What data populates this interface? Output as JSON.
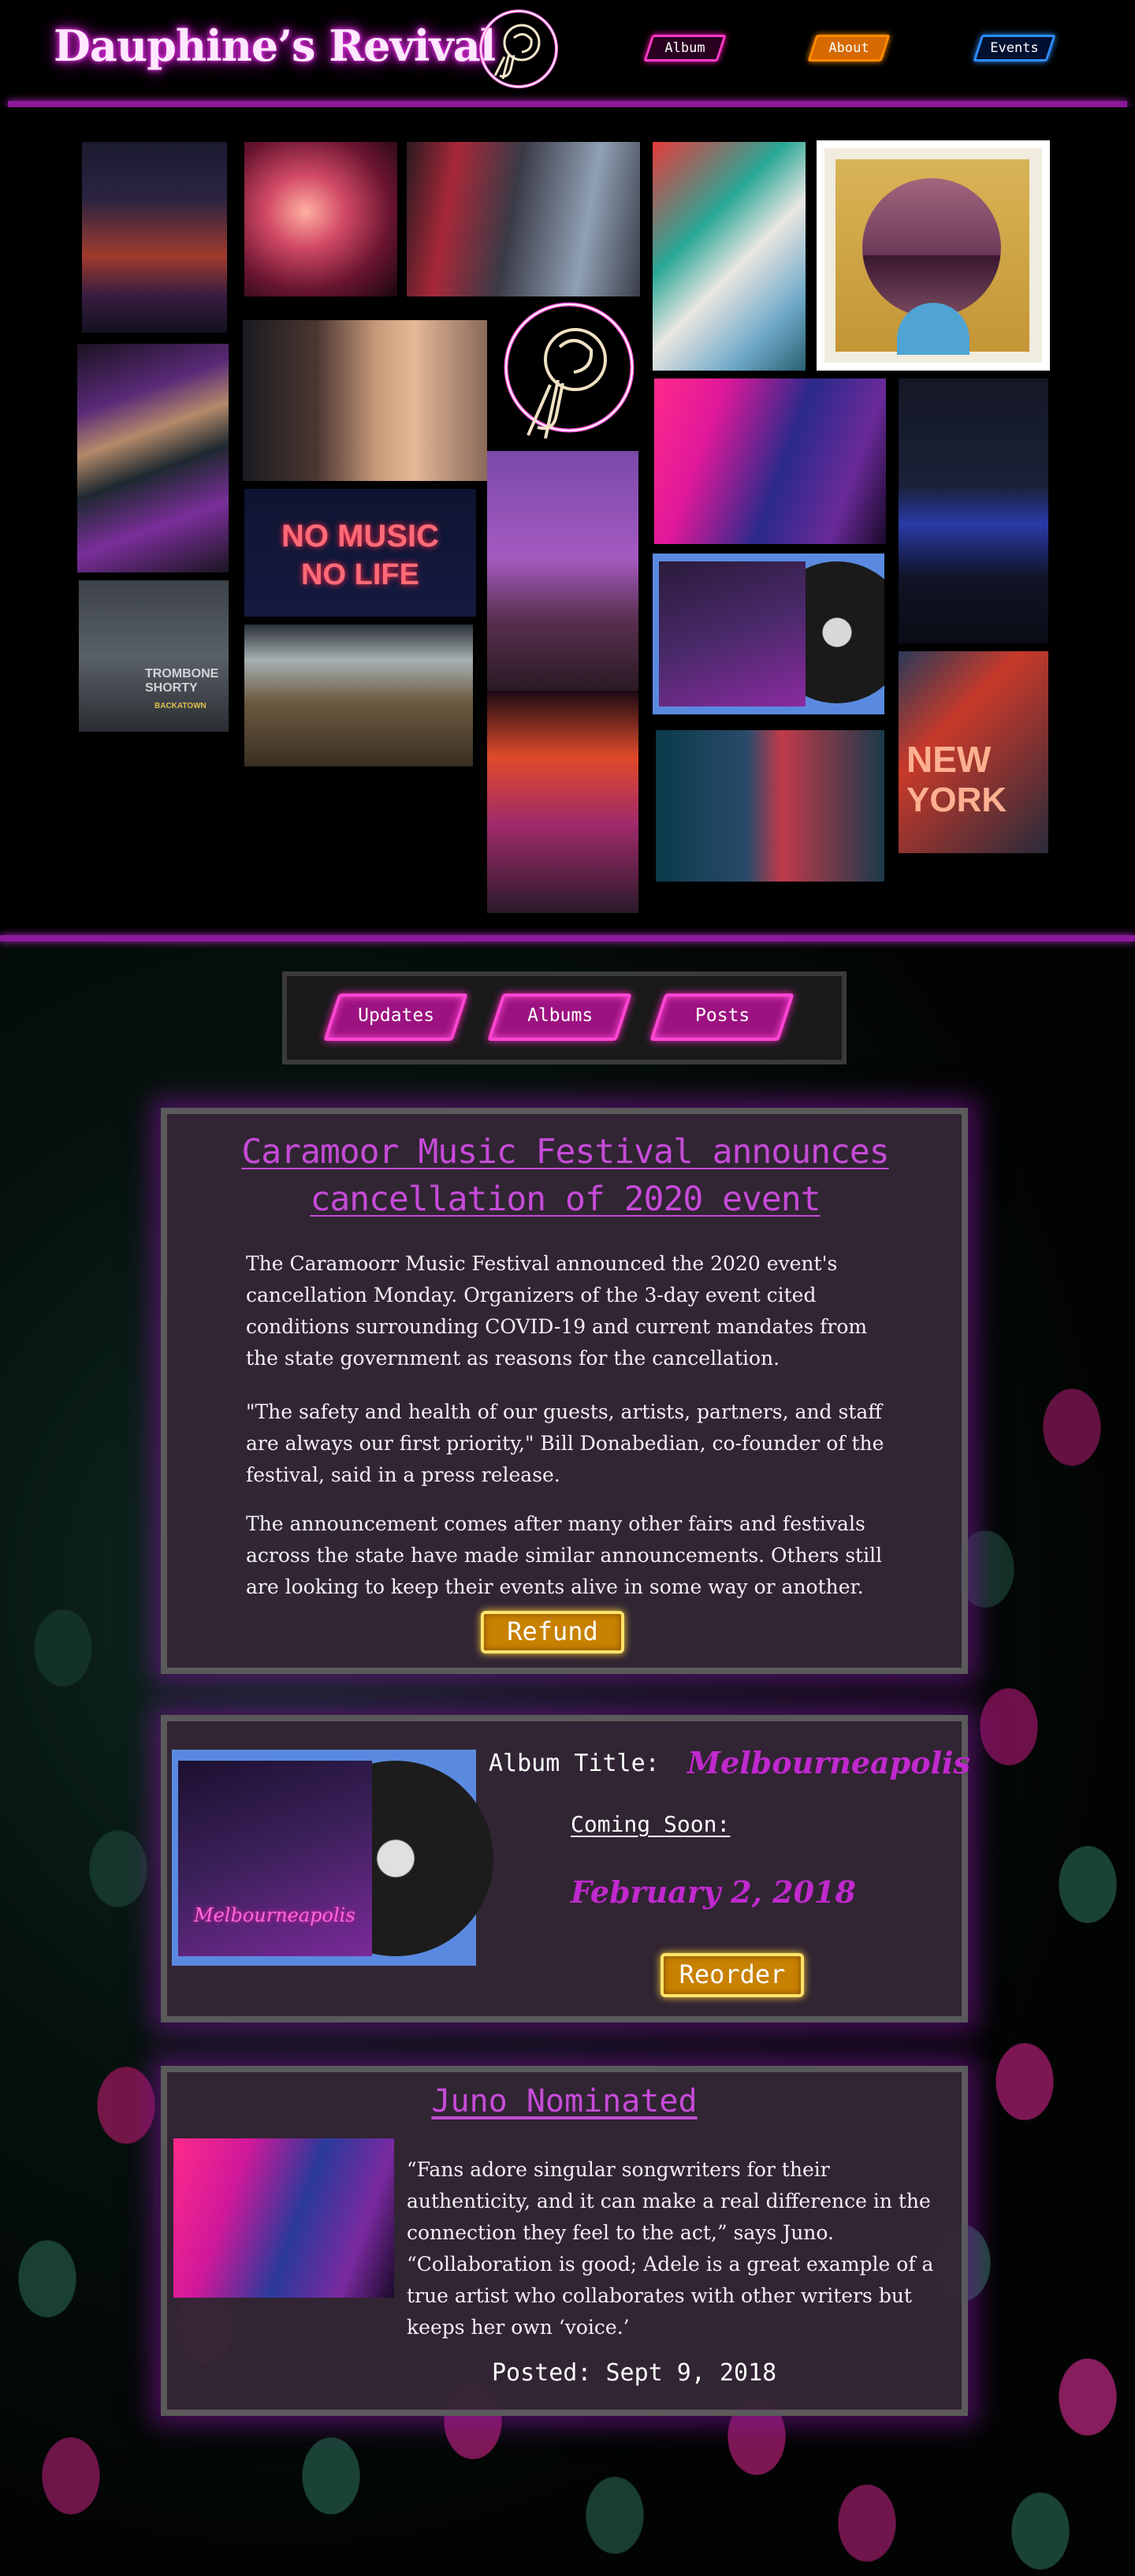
{
  "site": {
    "title": "Dauphine’s Revival"
  },
  "nav": {
    "album": "Album",
    "about": "About",
    "events": "Events"
  },
  "collage": {
    "no_music": "NO MUSIC",
    "no_life": "NO LIFE",
    "trombone_title": "TROMBONE SHORTY",
    "trombone_sub": "BACKATOWN",
    "new": "NEW",
    "york": "YORK",
    "album_script": "Melbourneapolis"
  },
  "tabs": {
    "updates": "Updates",
    "albums": "Albums",
    "posts": "Posts"
  },
  "article": {
    "title": "Caramoor Music Festival announces cancellation of 2020 event",
    "p1": "The Caramoorr Music Festival announced the 2020 event's cancellation Monday. Organizers of the 3-day event cited conditions surrounding COVID-19 and current mandates from the state government as reasons for the cancellation.",
    "p2": "\"The safety and health of our guests, artists, partners, and staff are always our first priority,\" Bill Donabedian, co-founder of the festival, said in a press release.",
    "p3": "The announcement comes after many other fairs and festivals across the state have made similar announcements. Others still are looking to keep their events alive in some way or another.",
    "button": "Refund"
  },
  "album": {
    "label": "Album Title:",
    "name": "Melbourneapolis",
    "coming": "Coming Soon:",
    "date": "February 2, 2018",
    "button": "Reorder"
  },
  "post": {
    "title": "Juno Nominated",
    "text": "“Fans adore singular songwriters for their authenticity, and it can make a real difference in the connection they feel to the act,” says Juno. “Collaboration is good; Adele is a great example of a true artist who collaborates with other writers but keeps her own ‘voice.’",
    "posted": "Posted: Sept 9, 2018"
  },
  "colors": {
    "accent": "#c64bd8",
    "neon_pink": "#ff38c8",
    "gold": "#c88100",
    "rule": "#8a1a9a"
  }
}
